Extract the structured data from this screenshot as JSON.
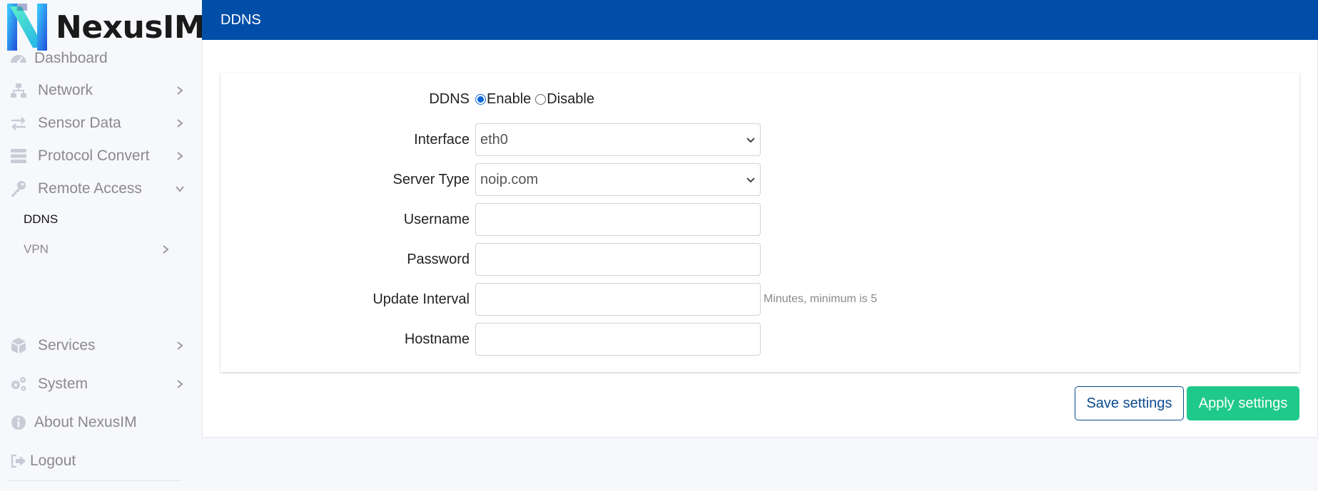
{
  "brand": {
    "name": "NexusIM",
    "colors": {
      "primary": "#004ea8",
      "accent": "#1ec98b"
    }
  },
  "sidebar": {
    "items": [
      {
        "label": "Dashboard",
        "icon": "speedometer-icon"
      },
      {
        "label": "Network",
        "icon": "network-icon"
      },
      {
        "label": "Sensor Data",
        "icon": "arrows-exchange-icon"
      },
      {
        "label": "Protocol Convert",
        "icon": "server-stack-icon"
      },
      {
        "label": "Remote Access",
        "icon": "key-icon"
      },
      {
        "label": "Services",
        "icon": "cube-icon"
      },
      {
        "label": "System",
        "icon": "gears-icon"
      },
      {
        "label": "About NexusIM",
        "icon": "info-icon"
      },
      {
        "label": "Logout",
        "icon": "logout-icon"
      }
    ],
    "sub_items": [
      {
        "label": "DDNS",
        "active": true
      },
      {
        "label": "VPN",
        "active": false
      }
    ]
  },
  "page": {
    "title": "DDNS"
  },
  "form": {
    "ddns": {
      "label": "DDNS",
      "options": [
        "Enable",
        "Disable"
      ],
      "selected": "Enable"
    },
    "interface": {
      "label": "Interface",
      "value": "eth0"
    },
    "server_type": {
      "label": "Server Type",
      "value": "noip.com"
    },
    "username": {
      "label": "Username",
      "value": ""
    },
    "password": {
      "label": "Password",
      "value": ""
    },
    "update_interval": {
      "label": "Update Interval",
      "value": "",
      "hint": "Minutes, minimum is 5"
    },
    "hostname": {
      "label": "Hostname",
      "value": ""
    }
  },
  "actions": {
    "save_label": "Save settings",
    "apply_label": "Apply settings"
  }
}
